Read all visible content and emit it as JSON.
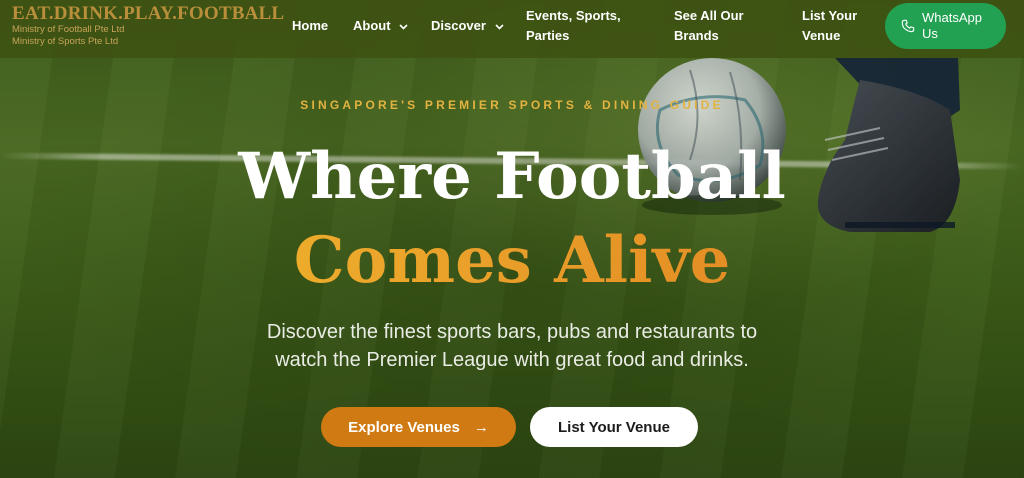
{
  "brand": {
    "title": "EAT.DRINK.PLAY.FOOTBALL",
    "sub1": "Ministry of Football Pte Ltd",
    "sub2": "Ministry of Sports Pte Ltd"
  },
  "nav": {
    "home": "Home",
    "about": "About",
    "discover": "Discover",
    "events_line1": "Events, Sports,",
    "events_line2": "Parties",
    "brands_line1": "See All Our",
    "brands_line2": "Brands",
    "list_line1": "List Your",
    "list_line2": "Venue",
    "whatsapp_line1": "WhatsApp",
    "whatsapp_line2": "Us"
  },
  "hero": {
    "eyebrow": "SINGAPORE'S PREMIER SPORTS & DINING GUIDE",
    "headline_line1": "Where Football",
    "headline_line2": "Comes Alive",
    "lede_line1": "Discover the finest sports bars, pubs and restaurants to",
    "lede_line2": "watch the Premier League with great food and drinks.",
    "cta_primary": "Explore Venues",
    "cta_primary_arrow": "→",
    "cta_secondary": "List Your Venue"
  },
  "colors": {
    "header_bg": "#3e5212",
    "brand_gold": "#b98f3c",
    "accent_orange": "#d07a14",
    "whatsapp_green": "#22a152",
    "eyebrow_gold": "#e3b340"
  },
  "icons": {
    "about_chevron": "chevron-down-icon",
    "discover_chevron": "chevron-down-icon",
    "whatsapp": "phone-icon",
    "cta_arrow": "arrow-right-icon"
  }
}
